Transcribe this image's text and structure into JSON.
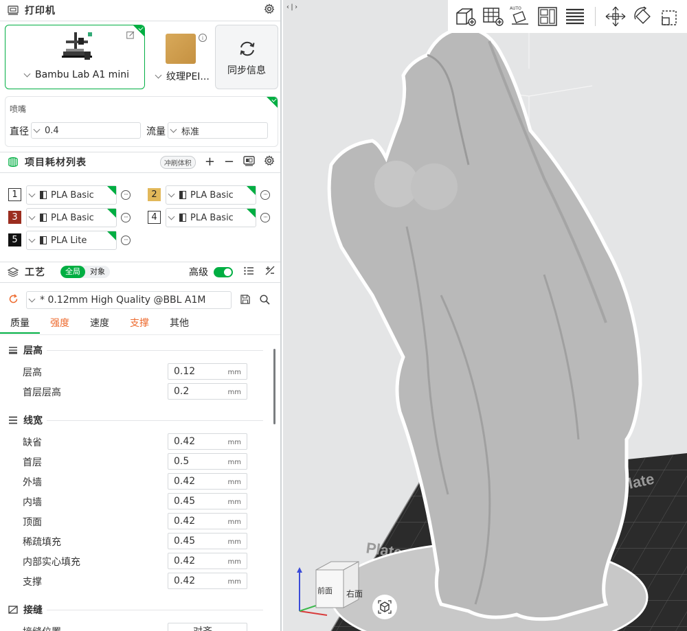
{
  "printer": {
    "section_title": "打印机",
    "printer_name": "Bambu Lab A1 mini",
    "plate_name": "纹理PEI...",
    "sync_label": "同步信息",
    "nozzle_label": "喷嘴",
    "diameter_label": "直径",
    "diameter_value": "0.4",
    "flow_label": "流量",
    "flow_value": "标准"
  },
  "filaments": {
    "section_title": "项目耗材列表",
    "flush_label": "冲刷体积",
    "slots": [
      {
        "num": "1",
        "name": "PLA Basic",
        "color": "#ffffff",
        "text_color": "#222222"
      },
      {
        "num": "2",
        "name": "PLA Basic",
        "color": "#e2b85a",
        "text_color": "#222222"
      },
      {
        "num": "3",
        "name": "PLA Basic",
        "color": "#9b2d1f",
        "text_color": "#ffffff"
      },
      {
        "num": "4",
        "name": "PLA Basic",
        "color": "#ffffff",
        "text_color": "#222222"
      },
      {
        "num": "5",
        "name": "PLA Lite",
        "color": "#111111",
        "text_color": "#ffffff"
      }
    ]
  },
  "process": {
    "section_title": "工艺",
    "global_label": "全局",
    "object_label": "对象",
    "advanced_label": "高级",
    "preset_name": "* 0.12mm High Quality @BBL A1M",
    "tabs": [
      {
        "label": "质量",
        "active": true,
        "warn": false
      },
      {
        "label": "强度",
        "active": false,
        "warn": true
      },
      {
        "label": "速度",
        "active": false,
        "warn": false
      },
      {
        "label": "支撑",
        "active": false,
        "warn": true
      },
      {
        "label": "其他",
        "active": false,
        "warn": false
      }
    ],
    "unit": "mm",
    "groups": {
      "layer_height": {
        "title": "层高",
        "rows": [
          {
            "label": "层高",
            "value": "0.12"
          },
          {
            "label": "首层层高",
            "value": "0.2"
          }
        ]
      },
      "line_width": {
        "title": "线宽",
        "rows": [
          {
            "label": "缺省",
            "value": "0.42"
          },
          {
            "label": "首层",
            "value": "0.5"
          },
          {
            "label": "外墙",
            "value": "0.42"
          },
          {
            "label": "内墙",
            "value": "0.45"
          },
          {
            "label": "顶面",
            "value": "0.42"
          },
          {
            "label": "稀疏填充",
            "value": "0.45"
          },
          {
            "label": "内部实心填充",
            "value": "0.42"
          },
          {
            "label": "支撑",
            "value": "0.42"
          }
        ]
      },
      "seam": {
        "title": "接缝",
        "rows": [
          {
            "label": "接缝位置",
            "value": "对齐"
          }
        ]
      }
    }
  },
  "viewport": {
    "cube_front": "前面",
    "cube_right": "右面",
    "plate_text": "Plate",
    "auto_label": "AUTO"
  },
  "colors": {
    "accent": "#00ae42",
    "warn": "#ed6a2e"
  }
}
